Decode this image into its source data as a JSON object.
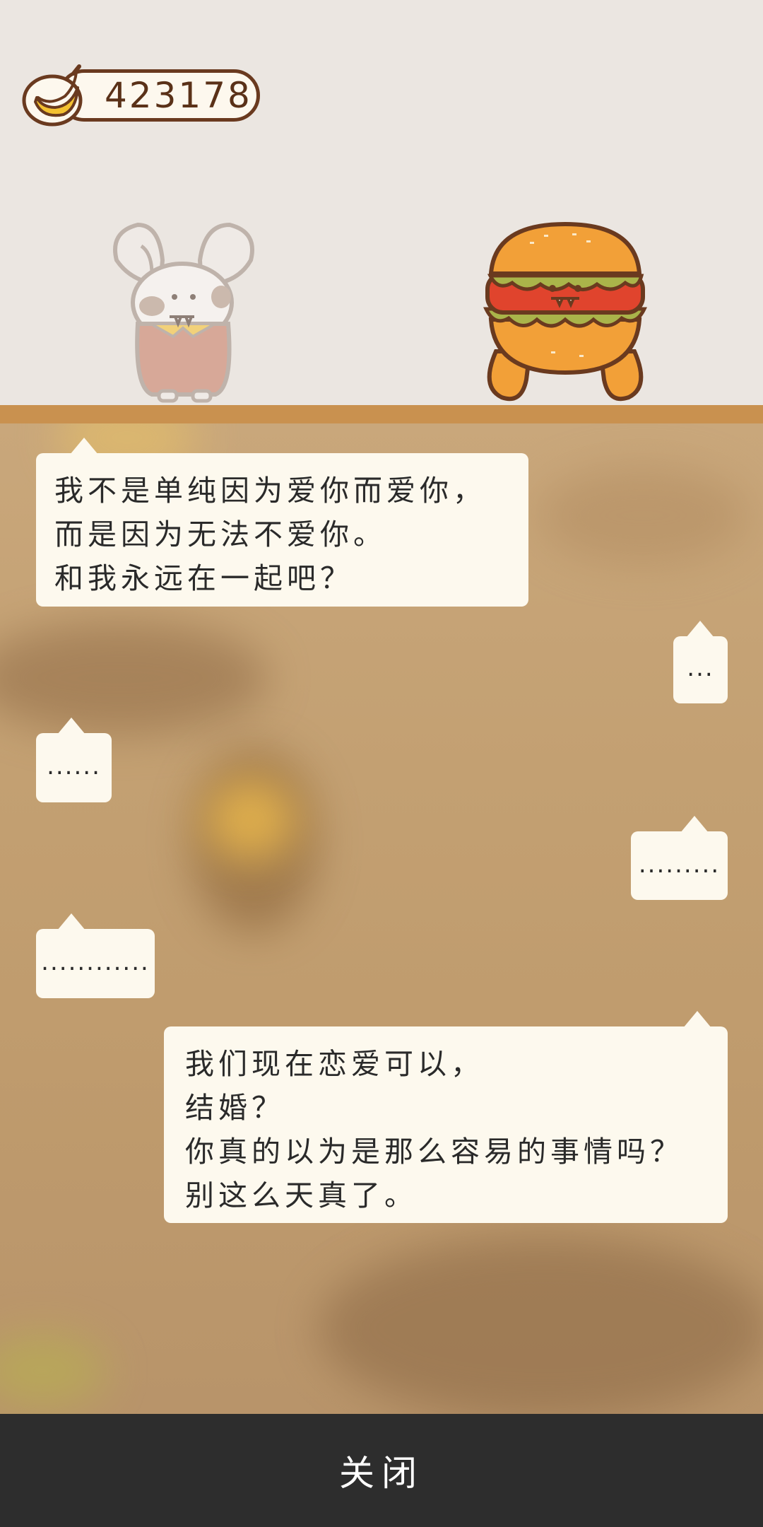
{
  "currency": {
    "amount": "423178",
    "icon": "banana-icon"
  },
  "characters": {
    "left": "bunny-character",
    "right": "burger-character"
  },
  "dialogue": [
    {
      "side": "left",
      "lines": [
        "我不是单纯因为爱你而爱你，",
        "而是因为无法不爱你。",
        "和我永远在一起吧？"
      ]
    },
    {
      "side": "right",
      "lines": [
        "..."
      ]
    },
    {
      "side": "left",
      "lines": [
        "......"
      ]
    },
    {
      "side": "right",
      "lines": [
        "........."
      ]
    },
    {
      "side": "left",
      "lines": [
        "............"
      ]
    },
    {
      "side": "right",
      "lines": [
        "我们现在恋爱可以，",
        "结婚？",
        "你真的以为是那么容易的事情吗？",
        "别这么天真了。"
      ]
    }
  ],
  "footer": {
    "close_label": "关闭"
  },
  "colors": {
    "bubble": "#fdf9ee",
    "footer": "#2d2d2d",
    "ledge": "#c9914f",
    "text": "#2a2a2a"
  }
}
